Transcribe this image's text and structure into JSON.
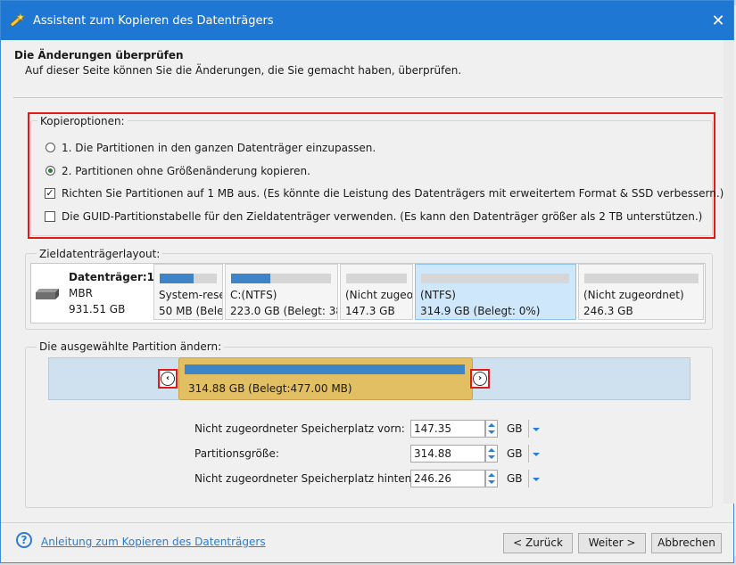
{
  "window": {
    "title": "Assistent zum Kopieren des Datenträgers",
    "close_glyph": "✕"
  },
  "header": {
    "title": "Die Änderungen überprüfen",
    "subtitle": "Auf dieser Seite können Sie die Änderungen, die Sie gemacht haben, überprüfen."
  },
  "copy_options": {
    "legend": "Kopieroptionen:",
    "radio1": "1. Die Partitionen in den ganzen Datenträger einzupassen.",
    "radio2": "2. Partitionen ohne Größenänderung kopieren.",
    "check1": "Richten Sie Partitionen auf 1 MB aus. (Es könnte die Leistung des Datenträgers mit erweitertem Format & SSD verbessern.)",
    "check2": "Die GUID-Partitionstabelle für den Zieldatenträger verwenden. (Es kann den Datenträger größer als 2 TB unterstützen.)",
    "selected_radio": 2,
    "check1_checked": true,
    "check2_checked": false
  },
  "layout": {
    "legend": "Zieldatenträgerlayout:",
    "disk": {
      "name": "Datenträger:1",
      "type": "MBR",
      "size": "931.51 GB"
    },
    "partitions": [
      {
        "l1": "System-rese",
        "l2": "50 MB (Bele",
        "used": 0.6
      },
      {
        "l1": "C:(NTFS)",
        "l2": "223.0 GB (Belegt: 38'",
        "used": 0.35
      },
      {
        "l1": "(Nicht zugeo",
        "l2": "147.3 GB",
        "used": 0
      },
      {
        "l1": "(NTFS)",
        "l2": "314.9 GB (Belegt: 0%)",
        "used": 0
      },
      {
        "l1": "(Nicht zugeordnet)",
        "l2": "246.3 GB",
        "used": 0
      }
    ]
  },
  "edit": {
    "legend": "Die ausgewählte Partition ändern:",
    "bar_label": "314.88 GB (Belegt:477.00 MB)",
    "left_glyph": "‹",
    "right_glyph": "›",
    "fields": [
      {
        "label": "Nicht zugeordneter Speicherplatz vorn:",
        "value": "147.35",
        "unit": "GB"
      },
      {
        "label": "Partitionsgröße:",
        "value": "314.88",
        "unit": "GB"
      },
      {
        "label": "Nicht zugeordneter Speicherplatz hinten:",
        "value": "246.26",
        "unit": "GB"
      }
    ]
  },
  "footer": {
    "help_glyph": "?",
    "help_link": "Anleitung zum Kopieren des Datenträgers",
    "back": "< Zurück",
    "next": "Weiter >",
    "cancel": "Abbrechen"
  },
  "colors": {
    "accent": "#1e78d3",
    "highlight": "#e01919",
    "selected_partition": "#e2bf63",
    "bar": "#3d85c6"
  }
}
